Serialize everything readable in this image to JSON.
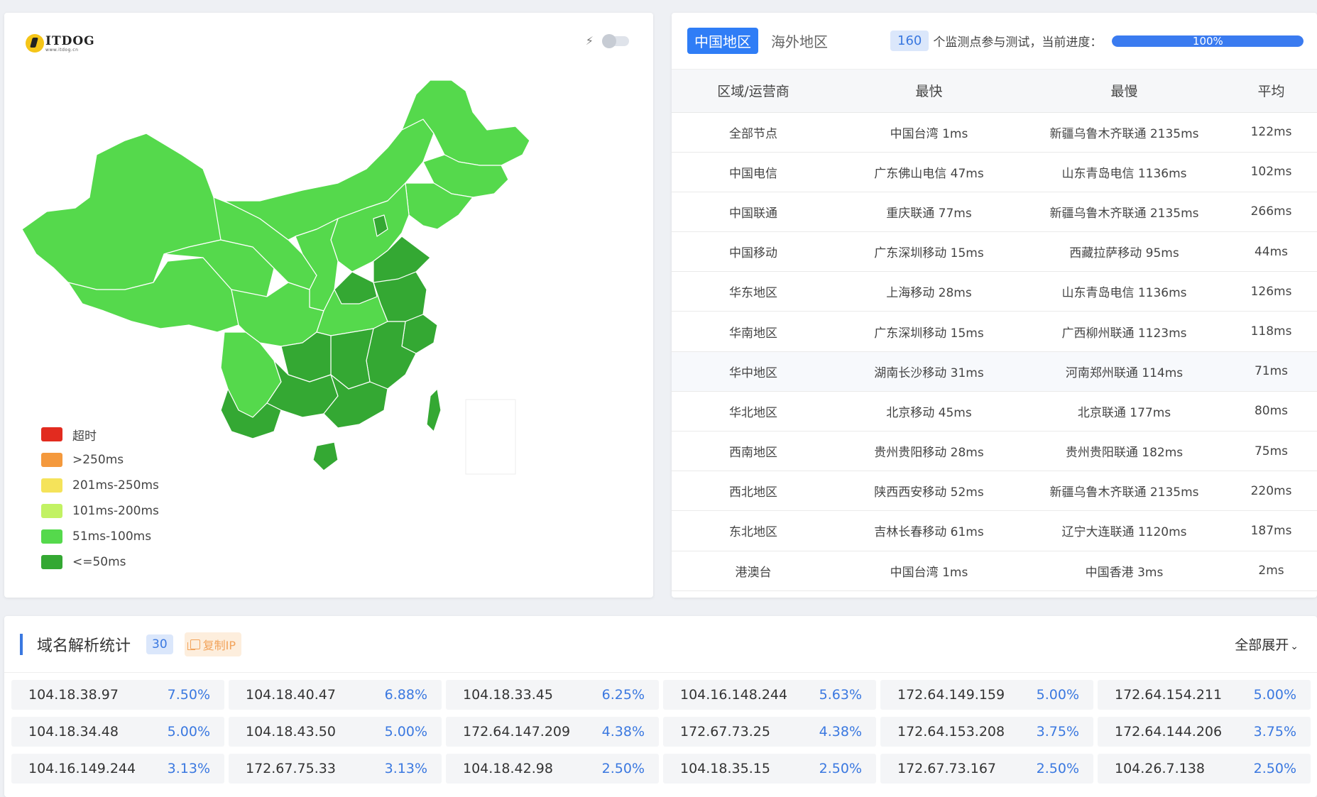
{
  "map": {
    "logo_name": "ITDOG",
    "logo_sub": "www.itdog.cn",
    "legend": [
      {
        "label": "超时",
        "color": "#e22b1f"
      },
      {
        "label": ">250ms",
        "color": "#f4993d"
      },
      {
        "label": "201ms-250ms",
        "color": "#f5e35a"
      },
      {
        "label": "101ms-200ms",
        "color": "#c2f263"
      },
      {
        "label": "51ms-100ms",
        "color": "#55d94c"
      },
      {
        "label": "<=50ms",
        "color": "#34a833"
      }
    ]
  },
  "stats": {
    "tabs": [
      "中国地区",
      "海外地区"
    ],
    "node_count": "160",
    "node_text": "个监测点参与测试，当前进度：",
    "progress_label": "100%",
    "progress_value": 1.0,
    "columns": [
      "区域/运营商",
      "最快",
      "最慢",
      "平均"
    ],
    "rows": [
      [
        "全部节点",
        "中国台湾 1ms",
        "新疆乌鲁木齐联通 2135ms",
        "122ms"
      ],
      [
        "中国电信",
        "广东佛山电信 47ms",
        "山东青岛电信 1136ms",
        "102ms"
      ],
      [
        "中国联通",
        "重庆联通 77ms",
        "新疆乌鲁木齐联通 2135ms",
        "266ms"
      ],
      [
        "中国移动",
        "广东深圳移动 15ms",
        "西藏拉萨移动 95ms",
        "44ms"
      ],
      [
        "华东地区",
        "上海移动 28ms",
        "山东青岛电信 1136ms",
        "126ms"
      ],
      [
        "华南地区",
        "广东深圳移动 15ms",
        "广西柳州联通 1123ms",
        "118ms"
      ],
      [
        "华中地区",
        "湖南长沙移动 31ms",
        "河南郑州联通 114ms",
        "71ms"
      ],
      [
        "华北地区",
        "北京移动 45ms",
        "北京联通 177ms",
        "80ms"
      ],
      [
        "西南地区",
        "贵州贵阳移动 28ms",
        "贵州贵阳联通 182ms",
        "75ms"
      ],
      [
        "西北地区",
        "陕西西安移动 52ms",
        "新疆乌鲁木齐联通 2135ms",
        "220ms"
      ],
      [
        "东北地区",
        "吉林长春移动 61ms",
        "辽宁大连联通 1120ms",
        "187ms"
      ],
      [
        "港澳台",
        "中国台湾 1ms",
        "中国香港 3ms",
        "2ms"
      ]
    ]
  },
  "dns": {
    "title": "域名解析统计",
    "count": "30",
    "copy_label": "复制IP",
    "expand_label": "全部展开",
    "items": [
      {
        "ip": "104.18.38.97",
        "pct": "7.50%"
      },
      {
        "ip": "104.18.40.47",
        "pct": "6.88%"
      },
      {
        "ip": "104.18.33.45",
        "pct": "6.25%"
      },
      {
        "ip": "104.16.148.244",
        "pct": "5.63%"
      },
      {
        "ip": "172.64.149.159",
        "pct": "5.00%"
      },
      {
        "ip": "172.64.154.211",
        "pct": "5.00%"
      },
      {
        "ip": "104.18.34.48",
        "pct": "5.00%"
      },
      {
        "ip": "104.18.43.50",
        "pct": "5.00%"
      },
      {
        "ip": "172.64.147.209",
        "pct": "4.38%"
      },
      {
        "ip": "172.67.73.25",
        "pct": "4.38%"
      },
      {
        "ip": "172.64.153.208",
        "pct": "3.75%"
      },
      {
        "ip": "172.64.144.206",
        "pct": "3.75%"
      },
      {
        "ip": "104.16.149.244",
        "pct": "3.13%"
      },
      {
        "ip": "172.67.75.33",
        "pct": "3.13%"
      },
      {
        "ip": "104.18.42.98",
        "pct": "2.50%"
      },
      {
        "ip": "104.18.35.15",
        "pct": "2.50%"
      },
      {
        "ip": "172.67.73.167",
        "pct": "2.50%"
      },
      {
        "ip": "104.26.7.138",
        "pct": "2.50%"
      }
    ]
  }
}
